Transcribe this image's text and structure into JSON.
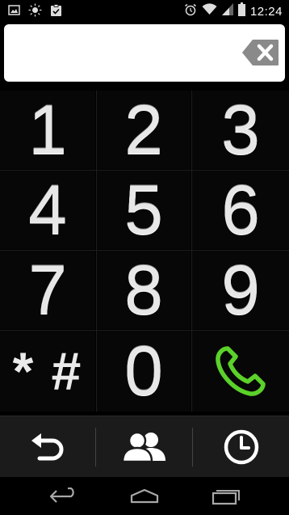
{
  "status_bar": {
    "time": "12:24",
    "left_icons": [
      "image-icon",
      "brightness-icon",
      "clipboard-check-icon"
    ],
    "right_icons": [
      "alarm-icon",
      "wifi-icon",
      "signal-icon",
      "battery-icon"
    ]
  },
  "dialer": {
    "number": "",
    "backspace_icon": "backspace-icon"
  },
  "keypad": {
    "keys": [
      {
        "label": "1"
      },
      {
        "label": "2"
      },
      {
        "label": "3"
      },
      {
        "label": "4"
      },
      {
        "label": "5"
      },
      {
        "label": "6"
      },
      {
        "label": "7"
      },
      {
        "label": "8"
      },
      {
        "label": "9"
      },
      {
        "label": "* #"
      },
      {
        "label": "0"
      },
      {
        "icon": "phone-call-icon"
      }
    ],
    "call_color": "#5bd12a"
  },
  "action_bar": {
    "items": [
      {
        "icon": "undo-icon"
      },
      {
        "icon": "contacts-icon"
      },
      {
        "icon": "clock-icon"
      }
    ]
  },
  "nav_bar": {
    "items": [
      {
        "icon": "back-icon"
      },
      {
        "icon": "home-icon"
      },
      {
        "icon": "recents-icon"
      }
    ]
  }
}
